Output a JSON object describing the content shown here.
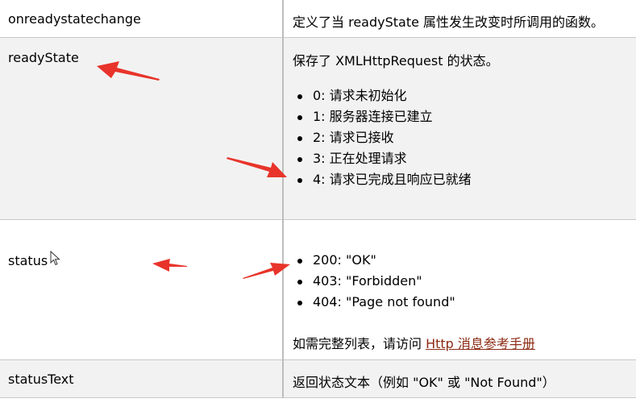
{
  "rows": [
    {
      "name": "onreadystatechange",
      "description": "定义了当 readyState 属性发生改变时所调用的函数。"
    },
    {
      "name": "readyState",
      "intro": "保存了 XMLHttpRequest 的状态。",
      "items": [
        "0: 请求未初始化",
        "1: 服务器连接已建立",
        "2: 请求已接收",
        "3: 正在处理请求",
        "4: 请求已完成且响应已就绪"
      ]
    },
    {
      "name": "status",
      "items": [
        "200: \"OK\"",
        "403: \"Forbidden\"",
        "404: \"Page not found\""
      ],
      "note_prefix": "如需完整列表，请访问 ",
      "note_link": "Http 消息参考手册"
    },
    {
      "name": "statusText",
      "description": "返回状态文本（例如 \"OK\" 或 \"Not Found\"）"
    }
  ],
  "colors": {
    "arrow": "#e8342a",
    "link": "#8c2a14",
    "alt_row": "#f2f2f2"
  },
  "icons": {
    "cursor": "mouse-pointer-icon",
    "annotations": "red-arrow-icon"
  }
}
